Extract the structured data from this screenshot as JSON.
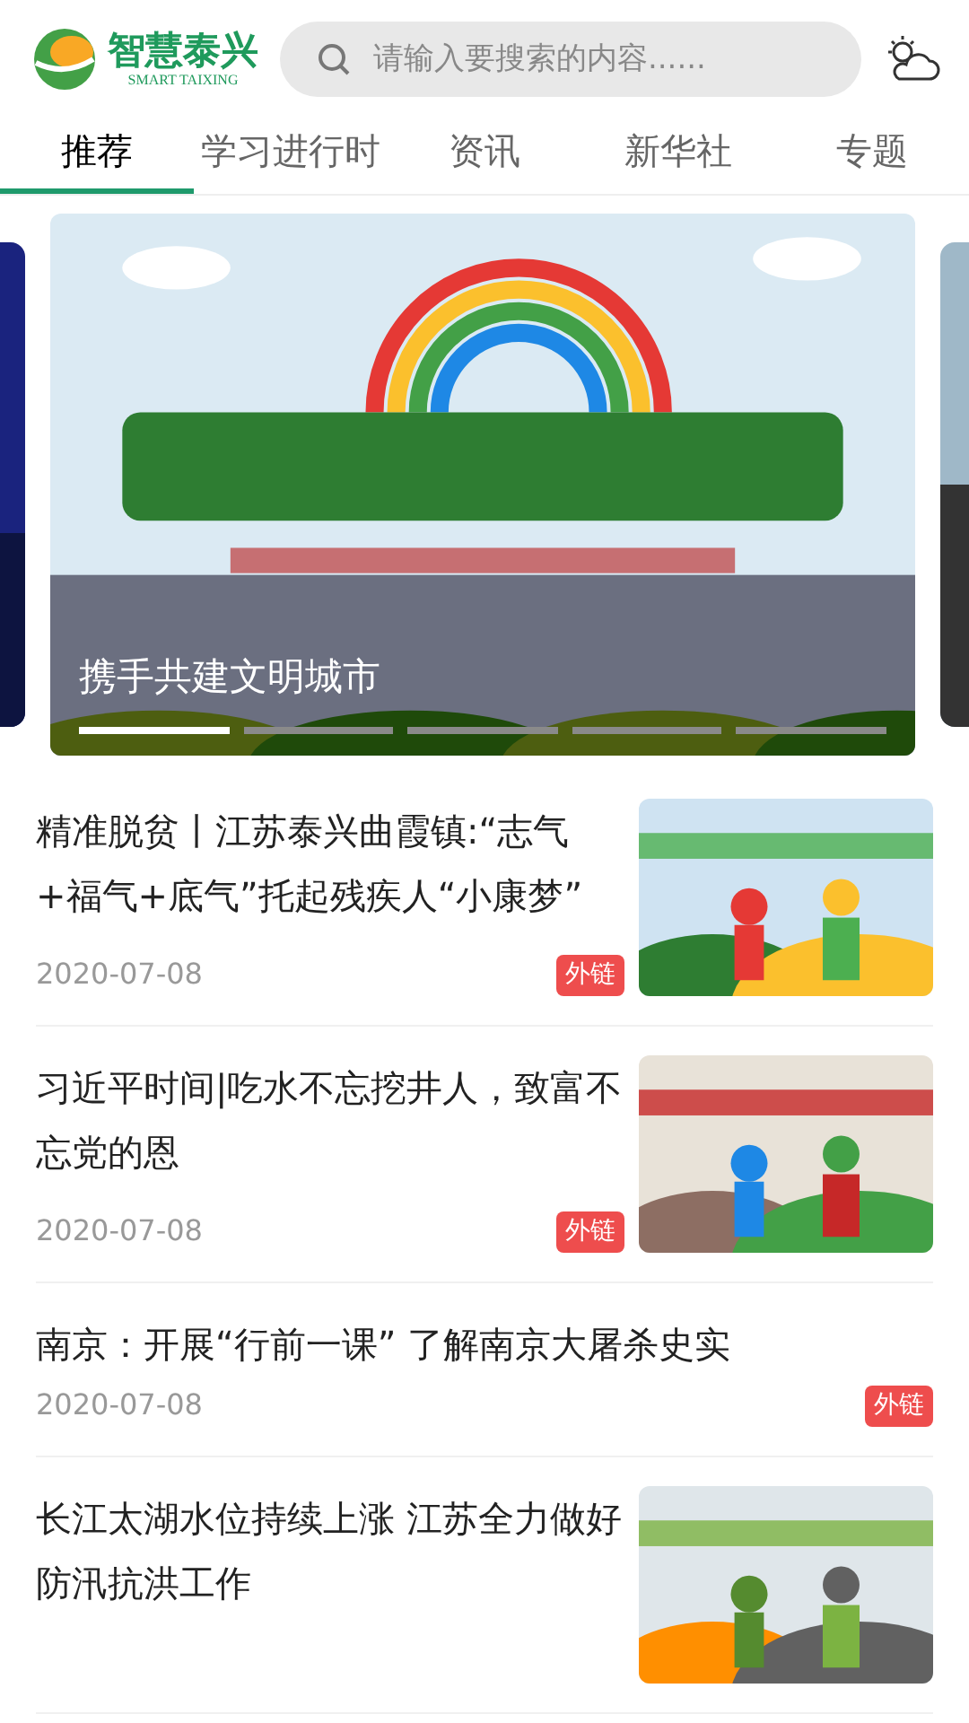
{
  "header": {
    "logo_title": "智慧泰兴",
    "logo_subtitle": "SMART TAIXING",
    "search": {
      "placeholder": "请输入要搜索的内容......"
    }
  },
  "tabs": [
    {
      "label": "推荐",
      "selected": true
    },
    {
      "label": "学习进行时",
      "selected": false
    },
    {
      "label": "资讯",
      "selected": false
    },
    {
      "label": "新华社",
      "selected": false
    },
    {
      "label": "专题",
      "selected": false
    }
  ],
  "banner": {
    "caption": "携手共建文明城市",
    "slides": [
      {
        "selected": true
      },
      {
        "selected": false
      },
      {
        "selected": false
      },
      {
        "selected": false
      },
      {
        "selected": false
      }
    ]
  },
  "articles": [
    {
      "kind": "thumb",
      "title": "精准脱贫丨江苏泰兴曲霞镇:“志气+福气+底气”托起残疾人“小康梦”",
      "date": "2020-07-08",
      "tag": "外链"
    },
    {
      "kind": "thumb",
      "title": "习近平时间|吃水不忘挖井人，致富不忘党的恩",
      "date": "2020-07-08",
      "tag": "外链"
    },
    {
      "kind": "text",
      "title": "南京：开展“行前一课” 了解南京大屠杀史实",
      "date": "2020-07-08",
      "tag": "外链"
    },
    {
      "kind": "thumb",
      "title": "长江太湖水位持续上涨 江苏全力做好防汛抗洪工作"
    }
  ]
}
